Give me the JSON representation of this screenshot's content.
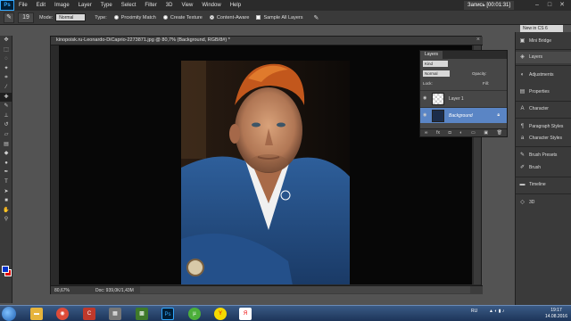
{
  "menubar": {
    "logo": "Ps",
    "items": [
      "File",
      "Edit",
      "Image",
      "Layer",
      "Type",
      "Select",
      "Filter",
      "3D",
      "View",
      "Window",
      "Help"
    ],
    "recording": "Запись [00:01:31]"
  },
  "options": {
    "brush_size": "19",
    "mode_label": "Mode:",
    "mode_value": "Normal",
    "type_label": "Type:",
    "proximity": "Proximity Match",
    "texture": "Create Texture",
    "content_aware": "Content-Aware",
    "sample_all": "Sample All Layers",
    "workspace": "New in CS 6"
  },
  "document": {
    "title": "kinopoisk.ru-Leonardo-DiCaprio-2273871.jpg @ 80,7% (Background, RGB/8#) *",
    "zoom": "80,67%",
    "doc_size": "Doc: 939,0K/1,43M"
  },
  "layers_panel": {
    "tabs": [
      "Layers"
    ],
    "kind": "Kind",
    "blend": "Normal",
    "opacity_label": "Opacity:",
    "lock_label": "Lock:",
    "fill_label": "Fill:",
    "layers": [
      {
        "name": "Layer 1",
        "active": false
      },
      {
        "name": "Background",
        "active": true
      }
    ]
  },
  "dock": {
    "items": [
      "Mini Bridge",
      "Layers",
      "Adjustments",
      "Properties",
      "Character",
      "Paragraph Styles",
      "Character Styles",
      "Brush Presets",
      "Brush",
      "Timeline",
      "3D"
    ]
  },
  "taskbar": {
    "apps": [
      "folder",
      "chrome",
      "ccleaner",
      "calculator",
      "minecraft",
      "photoshop",
      "utorrent",
      "yandex-browser",
      "yandex"
    ],
    "lang": "RU",
    "time": "19:17",
    "date": "14.08.2016"
  }
}
